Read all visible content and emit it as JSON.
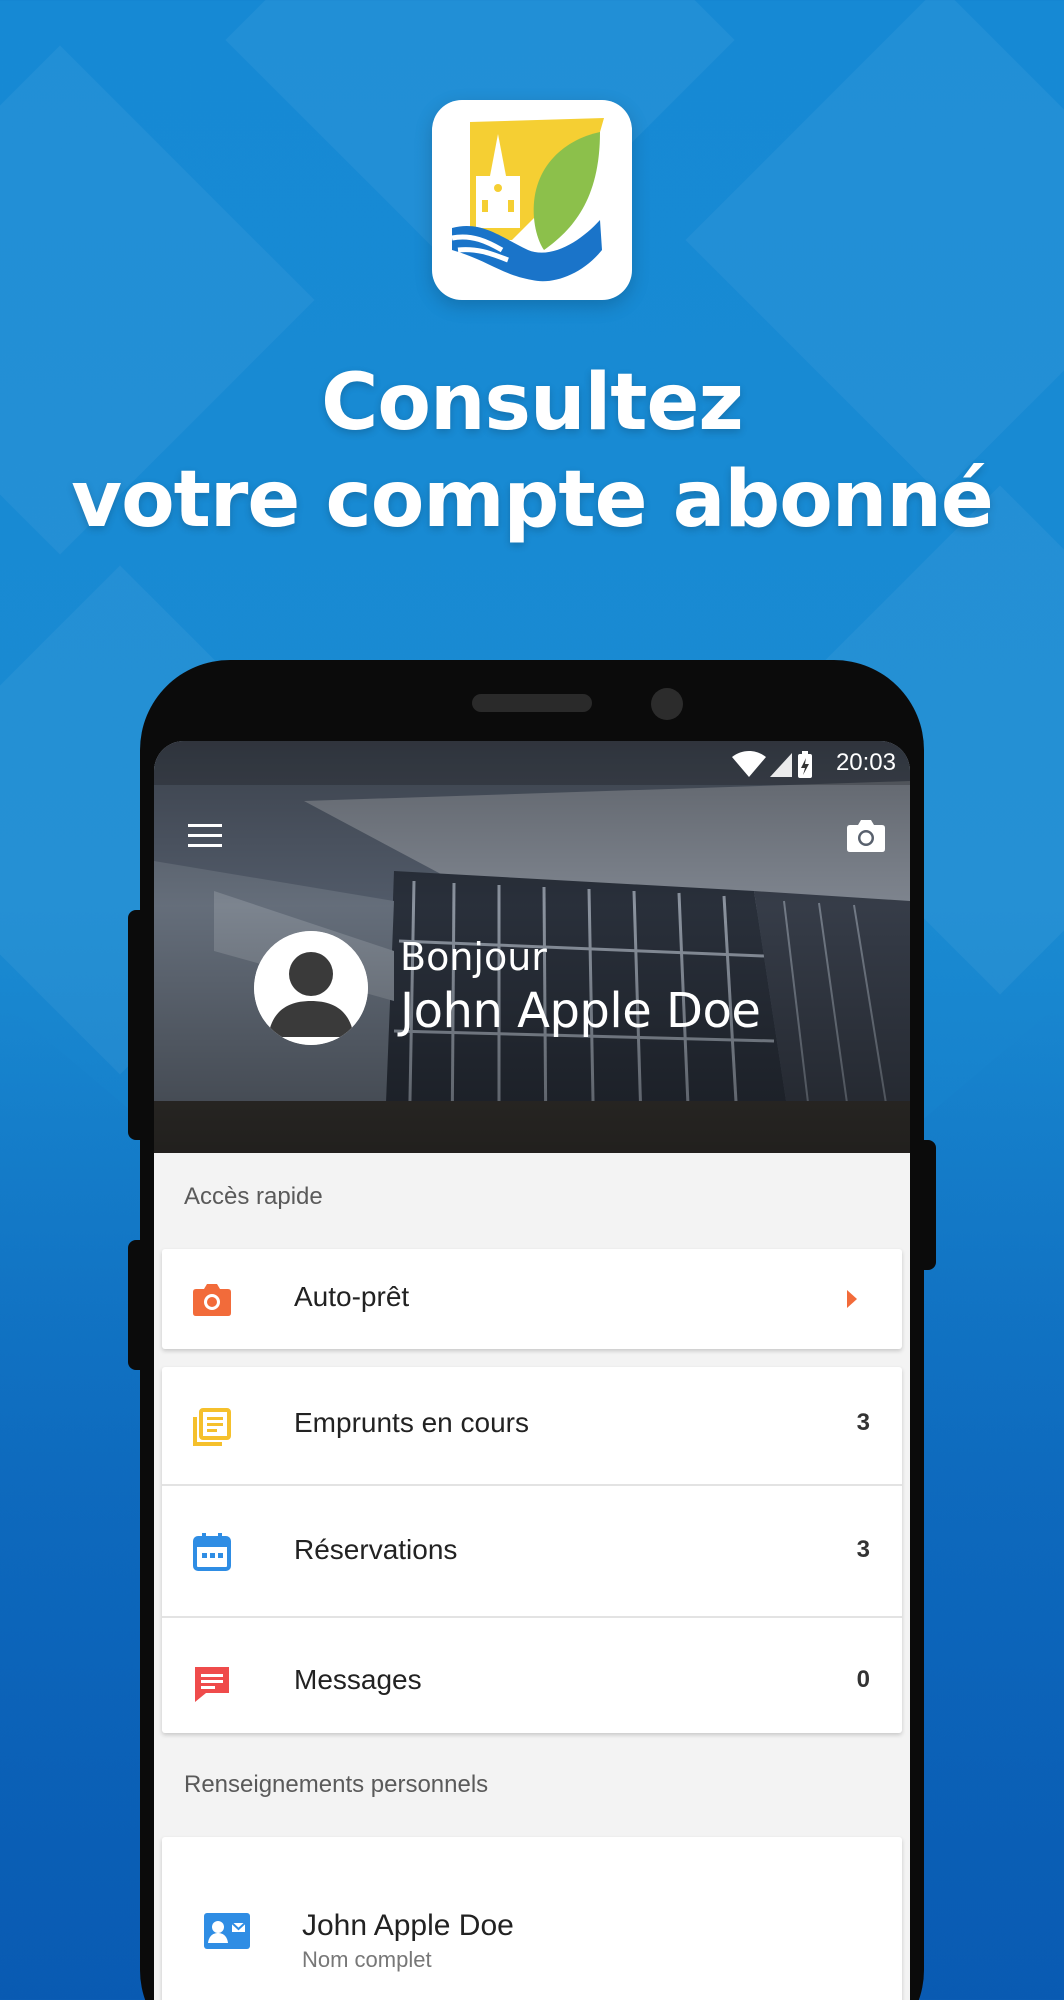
{
  "promo": {
    "headline_line1": "Consultez",
    "headline_line2": "votre compte abonné",
    "app_icon": "library-logo-icon"
  },
  "colors": {
    "background": "#1689d4",
    "accent_orange": "#f26b3a",
    "accent_yellow": "#f5c02c",
    "accent_blue": "#2f8de4",
    "accent_red": "#ef4b4b"
  },
  "statusbar": {
    "time": "20:03",
    "icons": [
      "wifi-icon",
      "signal-icon",
      "battery-charging-icon"
    ]
  },
  "header": {
    "menu_icon": "hamburger-menu-icon",
    "camera_icon": "camera-icon",
    "greeting": "Bonjour",
    "user_name": "John Apple Doe"
  },
  "quick_access": {
    "title": "Accès rapide",
    "items": [
      {
        "label": "Auto-prêt",
        "icon": "camera-icon",
        "count": ""
      },
      {
        "label": "Emprunts en cours",
        "icon": "list-icon",
        "count": "3"
      },
      {
        "label": "Réservations",
        "icon": "calendar-icon",
        "count": "3"
      },
      {
        "label": "Messages",
        "icon": "message-icon",
        "count": "0"
      }
    ]
  },
  "personal_info": {
    "title": "Renseignements personnels",
    "full_name_value": "John Apple Doe",
    "full_name_label": "Nom complet",
    "icon": "contact-card-icon"
  }
}
